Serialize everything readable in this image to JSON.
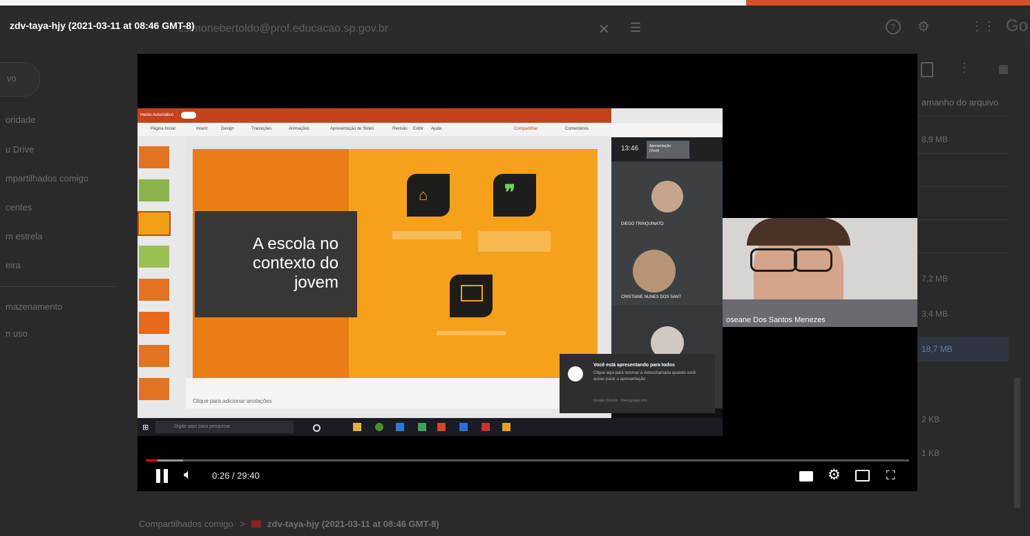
{
  "video": {
    "title": "zdv-taya-hjy (2021-03-11 at 08:46 GMT-8)",
    "time_current": "0:26",
    "time_total": "29:40",
    "time_display": "0:26 / 29:40",
    "progress": 0.015
  },
  "drive": {
    "header_partial": "csimonebertoldo@prof.educacao.sp.gov.br",
    "new_label": "vo",
    "sidebar": [
      "oridade",
      "u Drive",
      "mpartilhados comigo",
      "centes",
      "m estrela",
      "eira",
      "mazenamento",
      "n uso"
    ],
    "column_header": "amanho do arquivo",
    "sizes": [
      "8,9 MB",
      "7,2 MB",
      "3,4 MB",
      "18,7 MB",
      "2 KB",
      "1 KB"
    ],
    "logo_partial": "Go",
    "breadcrumb": {
      "root": "Compartilhados comigo",
      "separator": ">",
      "folder": "zdv-taya-hjy (2021-03-11 at 08:46 GMT-8)"
    }
  },
  "slide": {
    "title": "A escola no contexto do jovem",
    "notes_placeholder": "Clique para adicionar anotações",
    "ribbon_tabs": [
      "Página Inicial",
      "Inserir",
      "Design",
      "Transições",
      "Animações",
      "Apresentação de Slides",
      "Revisão",
      "Exibir",
      "Ajuda"
    ],
    "share_label": "Compartilhar",
    "comments_label": "Comentários",
    "autosave_label": "mento Automático"
  },
  "taskbar": {
    "search_placeholder": "Digite aqui para pesquisar"
  },
  "meet": {
    "clock": "13:46",
    "presentation_label": "Apresentação (Você)",
    "participants": [
      "DIEGO TRINQUINATO",
      "CRISTIANE NUNES DOS SANT"
    ],
    "toast_title": "Você está apresentando para todos",
    "toast_body": "Clique aqui para retornar à videochamada quando você quiser parar a apresentação",
    "toast_footer": "Google Chrome · meet.google.com"
  },
  "webcam": {
    "name": "oseane Dos Santos Menezes"
  },
  "colors": {
    "progress_played": "#ff0000",
    "slide_orange": "#f5a11b",
    "ppt_title_bar": "#c5421c",
    "folder_icon": "#8a1f25"
  }
}
